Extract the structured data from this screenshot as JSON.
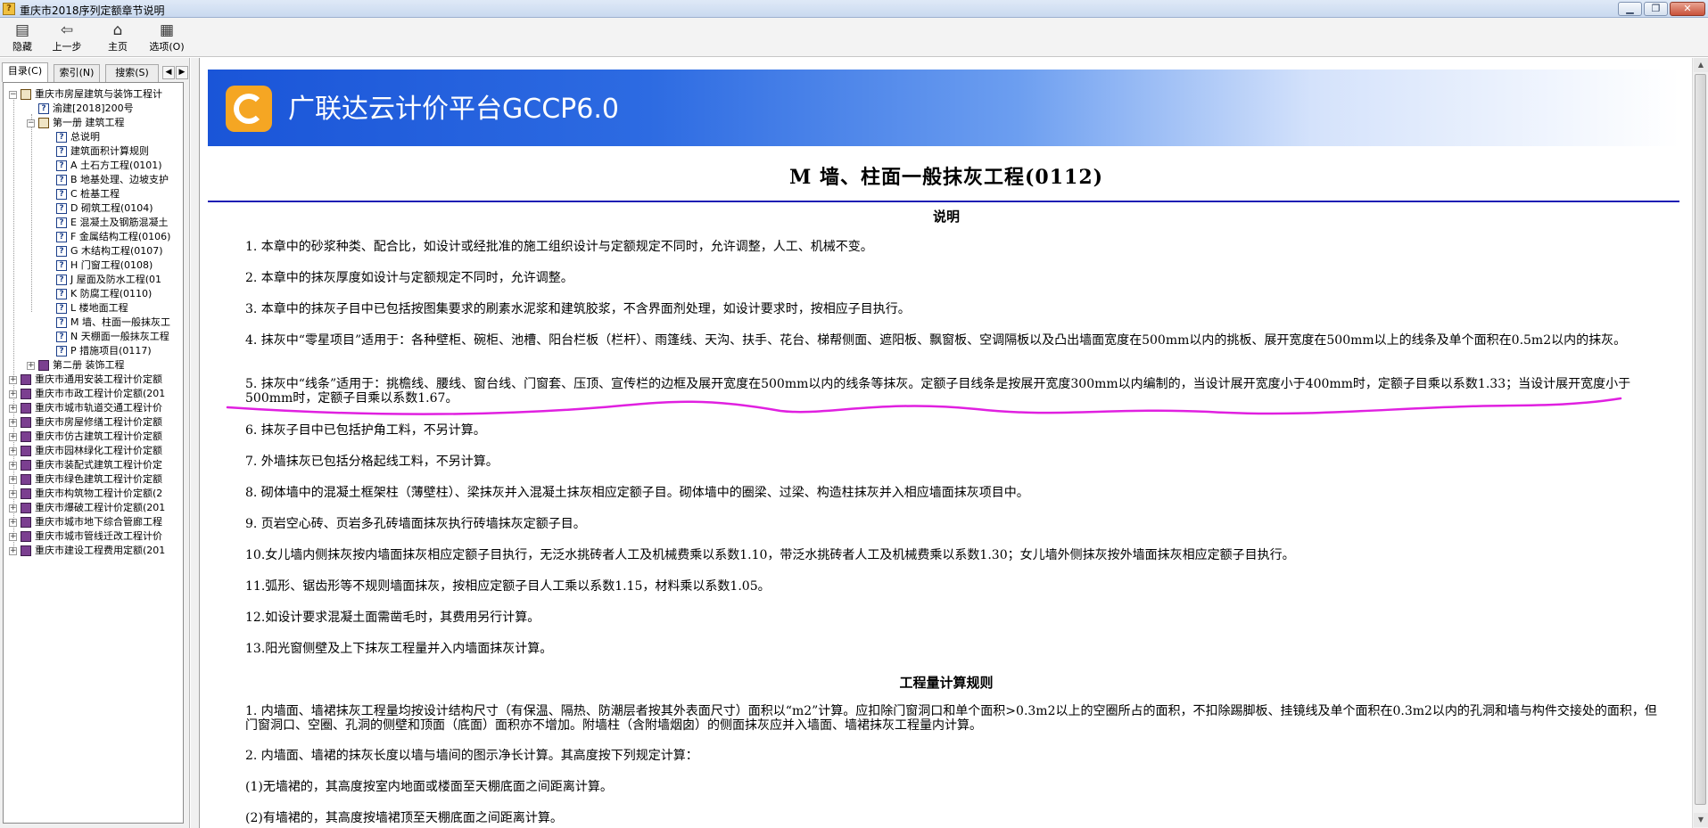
{
  "window": {
    "title": "重庆市2018序列定额章节说明"
  },
  "toolbar": [
    {
      "label": "隐藏",
      "icon": "hide-icon"
    },
    {
      "label": "上一步",
      "icon": "back-arrow-icon"
    },
    {
      "label": "主页",
      "icon": "home-icon"
    },
    {
      "label": "选项(O)",
      "icon": "options-icon"
    }
  ],
  "tabs": {
    "contents": "目录(C)",
    "index": "索引(N)",
    "search": "搜索(S)"
  },
  "tree": [
    {
      "text": "重庆市房屋建筑与装饰工程计",
      "level": 0,
      "icon": "book-open",
      "exp": "-"
    },
    {
      "text": "渝建[2018]200号",
      "level": 1,
      "icon": "page",
      "exp": ""
    },
    {
      "text": "第一册 建筑工程",
      "level": 1,
      "icon": "book-open",
      "exp": "-"
    },
    {
      "text": "总说明",
      "level": 2,
      "icon": "page",
      "exp": ""
    },
    {
      "text": "建筑面积计算规则",
      "level": 2,
      "icon": "page",
      "exp": ""
    },
    {
      "text": "A 土石方工程(0101)",
      "level": 2,
      "icon": "page",
      "exp": ""
    },
    {
      "text": "B 地基处理、边坡支护",
      "level": 2,
      "icon": "page",
      "exp": ""
    },
    {
      "text": "C 桩基工程",
      "level": 2,
      "icon": "page",
      "exp": ""
    },
    {
      "text": "D 砌筑工程(0104)",
      "level": 2,
      "icon": "page",
      "exp": ""
    },
    {
      "text": "E 混凝土及钢筋混凝土",
      "level": 2,
      "icon": "page",
      "exp": ""
    },
    {
      "text": "F 金属结构工程(0106)",
      "level": 2,
      "icon": "page",
      "exp": ""
    },
    {
      "text": "G 木结构工程(0107)",
      "level": 2,
      "icon": "page",
      "exp": ""
    },
    {
      "text": "H 门窗工程(0108)",
      "level": 2,
      "icon": "page",
      "exp": ""
    },
    {
      "text": "J 屋面及防水工程(01",
      "level": 2,
      "icon": "page",
      "exp": ""
    },
    {
      "text": "K 防腐工程(0110)",
      "level": 2,
      "icon": "page",
      "exp": ""
    },
    {
      "text": "L 楼地面工程",
      "level": 2,
      "icon": "page",
      "exp": ""
    },
    {
      "text": "M 墙、柱面一般抹灰工",
      "level": 2,
      "icon": "page",
      "exp": ""
    },
    {
      "text": "N 天棚面一般抹灰工程",
      "level": 2,
      "icon": "page",
      "exp": ""
    },
    {
      "text": "P 措施项目(0117)",
      "level": 2,
      "icon": "page",
      "exp": ""
    },
    {
      "text": "第二册 装饰工程",
      "level": 1,
      "icon": "book",
      "exp": "+"
    },
    {
      "text": "重庆市通用安装工程计价定额",
      "level": 0,
      "icon": "book",
      "exp": "+"
    },
    {
      "text": "重庆市市政工程计价定额(201",
      "level": 0,
      "icon": "book",
      "exp": "+"
    },
    {
      "text": "重庆市城市轨道交通工程计价",
      "level": 0,
      "icon": "book",
      "exp": "+"
    },
    {
      "text": "重庆市房屋修缮工程计价定额",
      "level": 0,
      "icon": "book",
      "exp": "+"
    },
    {
      "text": "重庆市仿古建筑工程计价定额",
      "level": 0,
      "icon": "book",
      "exp": "+"
    },
    {
      "text": "重庆市园林绿化工程计价定额",
      "level": 0,
      "icon": "book",
      "exp": "+"
    },
    {
      "text": "重庆市装配式建筑工程计价定",
      "level": 0,
      "icon": "book",
      "exp": "+"
    },
    {
      "text": "重庆市绿色建筑工程计价定额",
      "level": 0,
      "icon": "book",
      "exp": "+"
    },
    {
      "text": "重庆市构筑物工程计价定额(2",
      "level": 0,
      "icon": "book",
      "exp": "+"
    },
    {
      "text": "重庆市爆破工程计价定额(201",
      "level": 0,
      "icon": "book",
      "exp": "+"
    },
    {
      "text": "重庆市城市地下综合管廊工程",
      "level": 0,
      "icon": "book",
      "exp": "+"
    },
    {
      "text": "重庆市城市管线迁改工程计价",
      "level": 0,
      "icon": "book",
      "exp": "+"
    },
    {
      "text": "重庆市建设工程费用定额(201",
      "level": 0,
      "icon": "book",
      "exp": "+"
    }
  ],
  "banner": {
    "title": "广联达云计价平台GCCP6.0"
  },
  "document": {
    "chapter_title": "M 墙、柱面一般抹灰工程(0112)",
    "section1_title": "说明",
    "section1_items": [
      "1. 本章中的砂浆种类、配合比，如设计或经批准的施工组织设计与定额规定不同时，允许调整，人工、机械不变。",
      "2. 本章中的抹灰厚度如设计与定额规定不同时，允许调整。",
      "3. 本章中的抹灰子目中已包括按图集要求的刷素水泥浆和建筑胶浆，不含界面剂处理，如设计要求时，按相应子目执行。",
      "4. 抹灰中“零星项目”适用于：各种壁柜、碗柜、池槽、阳台栏板（栏杆）、雨篷线、天沟、扶手、花台、梯帮侧面、遮阳板、飘窗板、空调隔板以及凸出墙面宽度在500mm以内的挑板、展开宽度在500mm以上的线条及单个面积在0.5m2以内的抹灰。",
      "5. 抹灰中“线条”适用于：挑檐线、腰线、窗台线、门窗套、压顶、宣传栏的边框及展开宽度在500mm以内的线条等抹灰。定额子目线条是按展开宽度300mm以内编制的，当设计展开宽度小于400mm时，定额子目乘以系数1.33；当设计展开宽度小于500mm时，定额子目乘以系数1.67。",
      "6. 抹灰子目中已包括护角工料，不另计算。",
      "7. 外墙抹灰已包括分格起线工料，不另计算。",
      "8. 砌体墙中的混凝土框架柱（薄壁柱）、梁抹灰并入混凝土抹灰相应定额子目。砌体墙中的圈梁、过梁、构造柱抹灰并入相应墙面抹灰项目中。",
      "9. 页岩空心砖、页岩多孔砖墙面抹灰执行砖墙抹灰定额子目。",
      "10.女儿墙内侧抹灰按内墙面抹灰相应定额子目执行，无泛水挑砖者人工及机械费乘以系数1.10，带泛水挑砖者人工及机械费乘以系数1.30；女儿墙外侧抹灰按外墙面抹灰相应定额子目执行。",
      "11.弧形、锯齿形等不规则墙面抹灰，按相应定额子目人工乘以系数1.15，材料乘以系数1.05。",
      "12.如设计要求混凝土面需凿毛时，其费用另行计算。",
      "13.阳光窗侧壁及上下抹灰工程量并入内墙面抹灰计算。"
    ],
    "section2_title": "工程量计算规则",
    "section2_items": [
      "1. 内墙面、墙裙抹灰工程量均按设计结构尺寸（有保温、隔热、防潮层者按其外表面尺寸）面积以“m2”计算。应扣除门窗洞口和单个面积>0.3m2以上的空圈所占的面积，不扣除踢脚板、挂镜线及单个面积在0.3m2以内的孔洞和墙与构件交接处的面积，但门窗洞口、空圈、孔洞的侧壁和顶面（底面）面积亦不增加。附墙柱（含附墙烟囱）的侧面抹灰应并入墙面、墙裙抹灰工程量内计算。",
      "2. 内墙面、墙裙的抹灰长度以墙与墙间的图示净长计算。其高度按下列规定计算：",
      "(1)无墙裙的，其高度按室内地面或楼面至天棚底面之间距离计算。",
      "(2)有墙裙的，其高度按墙裙顶至天棚底面之间距离计算。"
    ]
  },
  "colors": {
    "rule": "#1e1eb4",
    "annotation": "#e020e0",
    "banner_start": "#1a55d8",
    "logo": "#f5a623"
  }
}
